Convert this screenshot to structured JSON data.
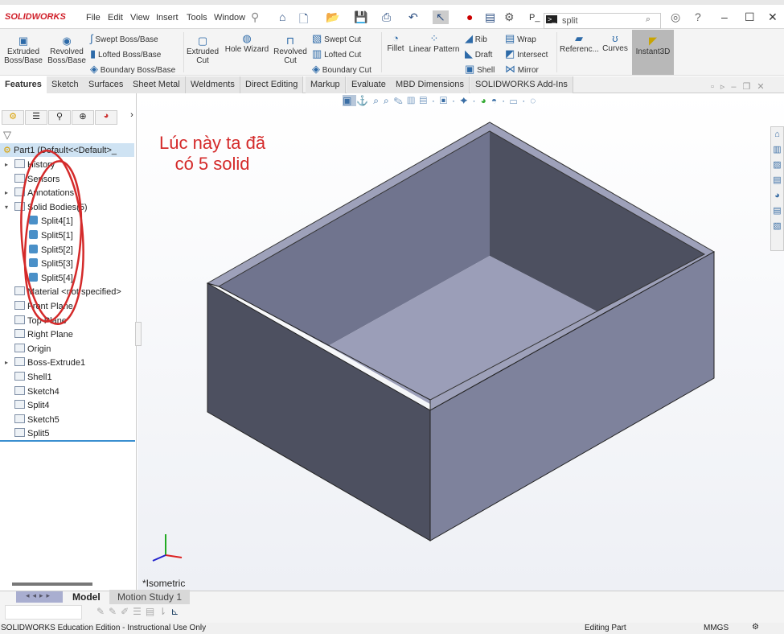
{
  "app": {
    "logo": "SOLIDWORKS",
    "menu": [
      "File",
      "Edit",
      "View",
      "Insert",
      "Tools",
      "Window"
    ],
    "search_value": "split",
    "quick_label": "P_"
  },
  "ribbon": {
    "big": [
      "Extruded Boss/Base",
      "Revolved Boss/Base",
      "Extruded Cut",
      "Hole Wizard",
      "Revolved Cut",
      "Fillet",
      "Linear Pattern",
      "Referenc...",
      "Curves",
      "Instant3D"
    ],
    "small": [
      "Swept Boss/Base",
      "Lofted Boss/Base",
      "Boundary Boss/Base",
      "Swept Cut",
      "Lofted Cut",
      "Boundary Cut",
      "Rib",
      "Draft",
      "Shell",
      "Wrap",
      "Intersect",
      "Mirror"
    ]
  },
  "tabs": [
    "Features",
    "Sketch",
    "Surfaces",
    "Sheet Metal",
    "Weldments",
    "Direct Editing",
    "Markup",
    "Evaluate",
    "MBD Dimensions",
    "SOLIDWORKS Add-Ins"
  ],
  "tree": {
    "root": "Part1  (Default<<Default>_",
    "items": [
      "History",
      "Sensors",
      "Annotations",
      "Solid Bodies(5)",
      "Split4[1]",
      "Split5[1]",
      "Split5[2]",
      "Split5[3]",
      "Split5[4]",
      "Material <not specified>",
      "Front Plane",
      "Top Plane",
      "Right Plane",
      "Origin",
      "Boss-Extrude1",
      "Shell1",
      "Sketch4",
      "Split4",
      "Sketch5",
      "Split5"
    ]
  },
  "annotation": {
    "line1": "Lúc này ta đã",
    "line2": "có 5 solid",
    "color": "#d42a2a"
  },
  "viewport": {
    "view_label": "*Isometric",
    "model_color": "#7e829c"
  },
  "bottom_tabs": [
    "Model",
    "Motion Study 1"
  ],
  "status": {
    "left": "SOLIDWORKS Education Edition - Instructional Use Only",
    "mode": "Editing Part",
    "units": "MMGS"
  }
}
